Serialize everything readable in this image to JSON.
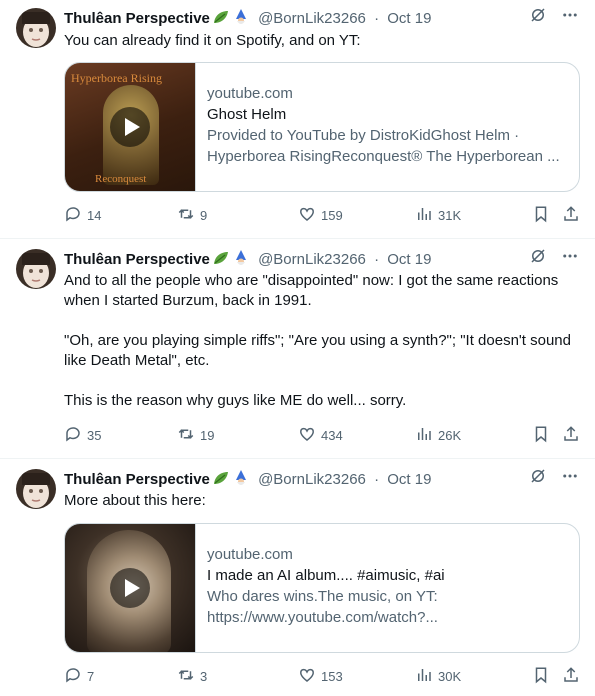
{
  "colors": {
    "text": "#0f1419",
    "secondary": "#536471",
    "border": "#cfd9de",
    "icon": "#536471"
  },
  "tweets": [
    {
      "author": "Thulêan Perspective",
      "handle": "@BornLik23266",
      "sep": "·",
      "date": "Oct 19",
      "text": "You can already find it on Spotify, and on YT:",
      "card": {
        "thumb_label_top": "Hyperborea Rising",
        "thumb_label_bottom": "Reconquest",
        "domain": "youtube.com",
        "title": "Ghost Helm",
        "desc1": "Provided to YouTube by DistroKidGhost Helm ·",
        "desc2": "Hyperborea RisingReconquest® The Hyperborean ..."
      },
      "replies": "14",
      "reposts": "9",
      "likes": "159",
      "views": "31K"
    },
    {
      "author": "Thulêan Perspective",
      "handle": "@BornLik23266",
      "sep": "·",
      "date": "Oct 19",
      "text": "And to all the people who are \"disappointed\" now: I got the same reactions when I started Burzum, back in 1991.\n\n\"Oh, are you playing simple riffs\"; \"Are you using a synth?\"; \"It doesn't sound like Death Metal\", etc.\n\nThis is the reason why guys like ME do well... sorry.",
      "replies": "35",
      "reposts": "19",
      "likes": "434",
      "views": "26K"
    },
    {
      "author": "Thulêan Perspective",
      "handle": "@BornLik23266",
      "sep": "·",
      "date": "Oct 19",
      "text": "More about this here:",
      "card": {
        "domain": "youtube.com",
        "title": "I made an AI album.... #aimusic, #ai",
        "desc1": "Who dares wins.The music, on YT:",
        "desc2": "https://www.youtube.com/watch?..."
      },
      "replies": "7",
      "reposts": "3",
      "likes": "153",
      "views": "30K"
    }
  ]
}
